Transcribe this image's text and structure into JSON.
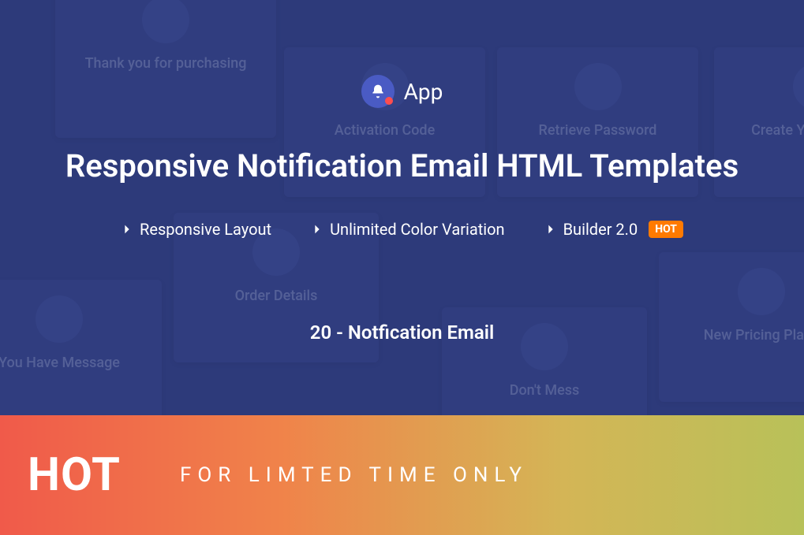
{
  "logo": {
    "app_name": "App"
  },
  "title": "Responsive Notification Email HTML Templates",
  "features": [
    {
      "label": "Responsive Layout",
      "badge": null
    },
    {
      "label": "Unlimited Color Variation",
      "badge": null
    },
    {
      "label": "Builder 2.0",
      "badge": "HOT"
    }
  ],
  "subtitle": "20 - Notfication Email",
  "footer": {
    "hot_label": "HOT",
    "limited_text": "FOR LIMTED TIME ONLY"
  },
  "bg_cards": [
    {
      "title": "Thank you for purchasing"
    },
    {
      "title": "Activation Code"
    },
    {
      "title": "Retrieve Password"
    },
    {
      "title": "Create Your Account"
    },
    {
      "title": "Order Details"
    },
    {
      "title": "You Have Message"
    },
    {
      "title": "Don't Mess"
    },
    {
      "title": "New Pricing Plans"
    }
  ]
}
